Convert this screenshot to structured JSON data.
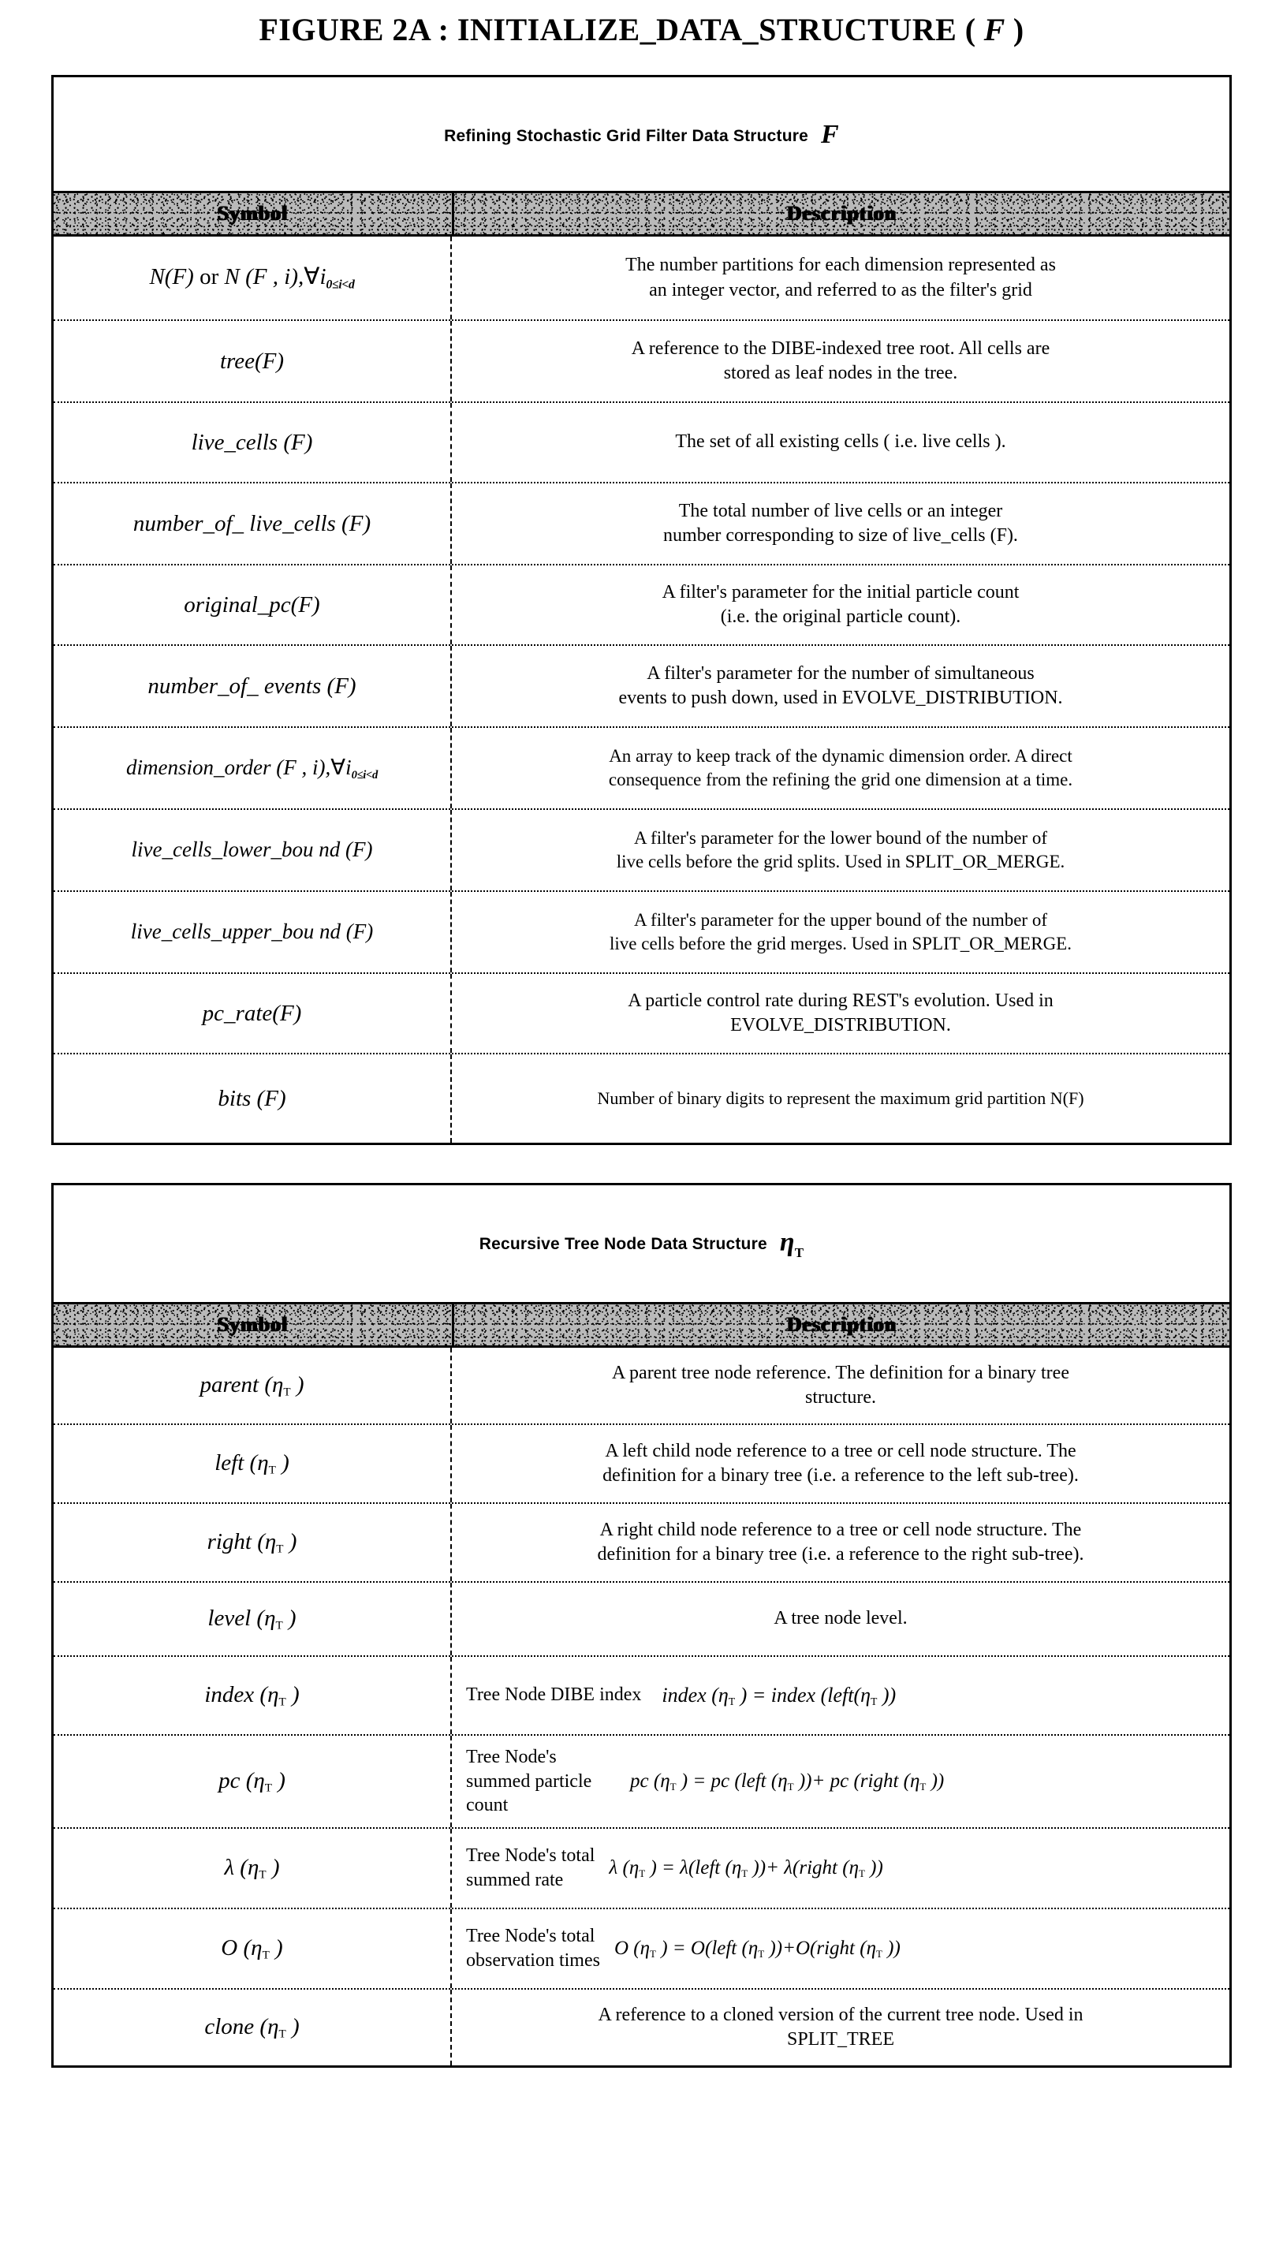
{
  "figure": {
    "title_prefix": "FIGURE 2A  : INITIALIZE_DATA_STRUCTURE  (",
    "title_symbol": "F",
    "title_suffix": ")"
  },
  "table1": {
    "caption_text": "Refining Stochastic Grid Filter Data Structure",
    "caption_symbol": "F",
    "columns": {
      "symbol": "Symbol",
      "description": "Description"
    },
    "rows": [
      {
        "symbol_main": "N(F)",
        "symbol_text": "N(F) or N (F , i),∀i0≤i<d",
        "desc_line1": "The number partitions for each dimension represented as",
        "desc_line2": "an integer vector, and referred to as the filter's grid"
      },
      {
        "symbol_main": "tree(F)",
        "symbol_text": "tree(F)",
        "desc_line1": "A reference to the DIBE-indexed tree root. All cells are",
        "desc_line2": "stored as leaf nodes in the tree."
      },
      {
        "symbol_main": "live_cells (F)",
        "symbol_text": "live_cells (F)",
        "desc_line1": "The set of all existing cells ( i.e.  live cells ).",
        "desc_line2": ""
      },
      {
        "symbol_main": "number_of_ live_cells (F)",
        "symbol_text": "number_of_ live_cells (F)",
        "desc_line1": "The total number of live cells or an integer",
        "desc_line2": "number corresponding to size of  live_cells (F)."
      },
      {
        "symbol_main": "original_pc(F)",
        "symbol_text": "original_pc(F)",
        "desc_line1": "A filter's parameter for the initial particle count",
        "desc_line2": "(i.e. the original particle count)."
      },
      {
        "symbol_main": "number_of_ events (F)",
        "symbol_text": "number_of_ events (F)",
        "desc_line1": "A filter's parameter for the number of simultaneous",
        "desc_line2": "events to push down, used in EVOLVE_DISTRIBUTION."
      },
      {
        "symbol_main": "dimension_order (F , i)",
        "symbol_text": "dimension_order (F , i),∀i0≤i<d",
        "desc_line1": "An array to keep track of the dynamic dimension order. A direct",
        "desc_line2": "consequence from the refining the grid one dimension at a time."
      },
      {
        "symbol_main": "live_cells_lower_bou nd (F)",
        "symbol_text": "live_cells_lower_bou nd (F)",
        "desc_line1": "A filter's parameter for the lower bound of the number of",
        "desc_line2": "live cells before the grid splits. Used in SPLIT_OR_MERGE."
      },
      {
        "symbol_main": "live_cells_upper_bou nd  (F)",
        "symbol_text": "live_cells_upper_bou nd  (F)",
        "desc_line1": "A filter's parameter for the upper bound of the number of",
        "desc_line2": "live cells before the grid merges. Used in SPLIT_OR_MERGE."
      },
      {
        "symbol_main": "pc_rate(F)",
        "symbol_text": "pc_rate(F)",
        "desc_line1": "A particle control rate during REST's evolution. Used in",
        "desc_line2": "EVOLVE_DISTRIBUTION."
      },
      {
        "symbol_main": "bits (F)",
        "symbol_text": "bits (F)",
        "desc_line1": "Number of binary digits to represent the maximum grid partition N(F)",
        "desc_line2": ""
      }
    ]
  },
  "table2": {
    "caption_text": "Recursive Tree Node Data Structure",
    "caption_symbol": "η",
    "caption_symbol_sub": "T",
    "columns": {
      "symbol": "Symbol",
      "description": "Description"
    },
    "rows": [
      {
        "symbol_text": "parent (ηT)",
        "desc_line1": "A parent tree node reference. The definition for a binary tree",
        "desc_line2": "structure.",
        "formula": ""
      },
      {
        "symbol_text": "left (ηT)",
        "desc_line1": "A left child node reference to a tree or cell node structure. The",
        "desc_line2": "definition for a binary tree (i.e. a reference to the left sub-tree).",
        "formula": ""
      },
      {
        "symbol_text": "right (ηT)",
        "desc_line1": "A right child node reference to a tree or cell node structure. The",
        "desc_line2": "definition for a binary tree (i.e. a reference to the right sub-tree).",
        "formula": ""
      },
      {
        "symbol_text": "level (ηT)",
        "desc_line1": "A tree node level.",
        "desc_line2": "",
        "formula": ""
      },
      {
        "symbol_text": "index (ηT)",
        "desc_line1": "Tree Node DIBE index",
        "desc_line2": "",
        "formula": "index (ηT ) = index (left(ηT ))"
      },
      {
        "symbol_text": "pc (ηT)",
        "desc_line1": "Tree Node's",
        "desc_line2": "summed particle count",
        "formula": "pc (ηT ) = pc (left (ηT ))+ pc (right (ηT ))"
      },
      {
        "symbol_text": "λ (ηT)",
        "desc_line1": "Tree Node's total",
        "desc_line2": "summed rate",
        "formula": "λ (ηT ) = λ(left (ηT ))+ λ(right (ηT ))"
      },
      {
        "symbol_text": "O (ηT)",
        "desc_line1": "Tree Node's total",
        "desc_line2": "observation times",
        "formula": "O (ηT ) = O(left (ηT ))+O(right (ηT ))"
      },
      {
        "symbol_text": "clone (ηT)",
        "desc_line1": "A reference to a cloned version of the current tree node.  Used in",
        "desc_line2": "SPLIT_TREE",
        "formula": ""
      }
    ]
  }
}
